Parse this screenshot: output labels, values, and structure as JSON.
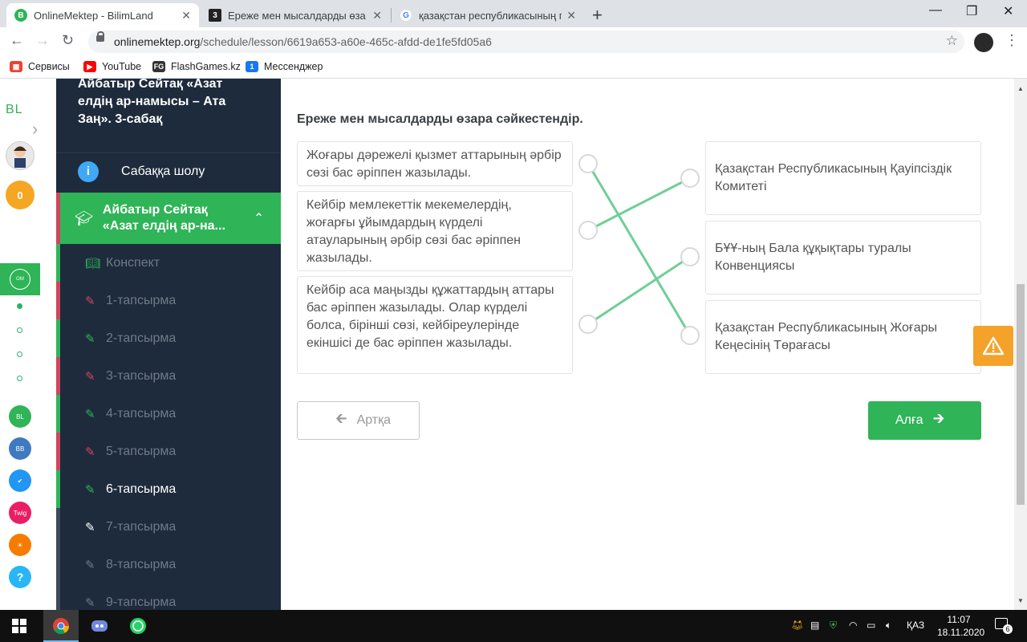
{
  "browser": {
    "tabs": [
      {
        "title": "OnlineMektep - BilimLand",
        "active": true
      },
      {
        "title": "Ереже мен мысалдарды өзара с",
        "active": false
      },
      {
        "title": "қазақстан республикасының пр",
        "active": false
      }
    ],
    "url_host": "onlinemektep.org",
    "url_path": "/schedule/lesson/6619a653-a60e-465c-afdd-de1fe5fd05a6",
    "bookmarks": [
      "Сервисы",
      "YouTube",
      "FlashGames.kz",
      "Мессенджер"
    ]
  },
  "rail": {
    "coins": "0",
    "logo": "BL"
  },
  "sidebar": {
    "lesson_title": "Айбатыр Сейтақ «Азат елдің ар-намысы – Ата Заң». 3-сабақ",
    "overview_label": "Сабаққа шолу",
    "active_lesson_label": "Айбатыр Сейтақ «Азат елдің ар-на...",
    "items": [
      {
        "label": "Конспект",
        "status": "done",
        "icon": "book-icon"
      },
      {
        "label": "1-тапсырма",
        "status": "wrong",
        "icon": "edit-icon"
      },
      {
        "label": "2-тапсырма",
        "status": "done",
        "icon": "edit-icon"
      },
      {
        "label": "3-тапсырма",
        "status": "wrong",
        "icon": "edit-icon"
      },
      {
        "label": "4-тапсырма",
        "status": "done",
        "icon": "edit-icon"
      },
      {
        "label": "5-тапсырма",
        "status": "wrong",
        "icon": "edit-icon"
      },
      {
        "label": "6-тапсырма",
        "status": "current",
        "icon": "edit-icon"
      },
      {
        "label": "7-тапсырма",
        "status": "pending",
        "icon": "edit-icon"
      },
      {
        "label": "8-тапсырма",
        "status": "pending",
        "icon": "edit-icon"
      },
      {
        "label": "9-тапсырма",
        "status": "pending",
        "icon": "edit-icon"
      }
    ]
  },
  "task": {
    "question": "Ереже мен мысалдарды өзара сәйкестендір.",
    "left_items": [
      "Жоғары дәрежелі қызмет аттарының әрбір сөзі бас әріппен жазылады.",
      "Кейбір мемлекеттік мекемелердің, жоғарғы ұйымдардың күрделі атауларының әрбір сөзі бас әріппен жазылады.",
      "Кейбір аса маңызды құжаттардың аттары бас әріппен жазылады. Олар күрделі болса, бірінші сөзі, кейбіреулерінде екіншісі де бас әріппен жазылады."
    ],
    "right_items": [
      "Қазақстан Республикасының Қауіпсіздік Комитеті",
      "БҰҰ-ның Бала құқықтары туралы Конвенциясы",
      "Қазақстан Республикасының Жоғары Кеңесінің Төрағасы"
    ],
    "matches": [
      [
        0,
        2
      ],
      [
        1,
        0
      ],
      [
        2,
        1
      ]
    ],
    "line_color": "#6fcf97",
    "back_label": "Артқа",
    "next_label": "Алға"
  },
  "taskbar": {
    "lang": "ҚАЗ",
    "time": "11:07",
    "date": "18.11.2020",
    "notifications": "6"
  }
}
